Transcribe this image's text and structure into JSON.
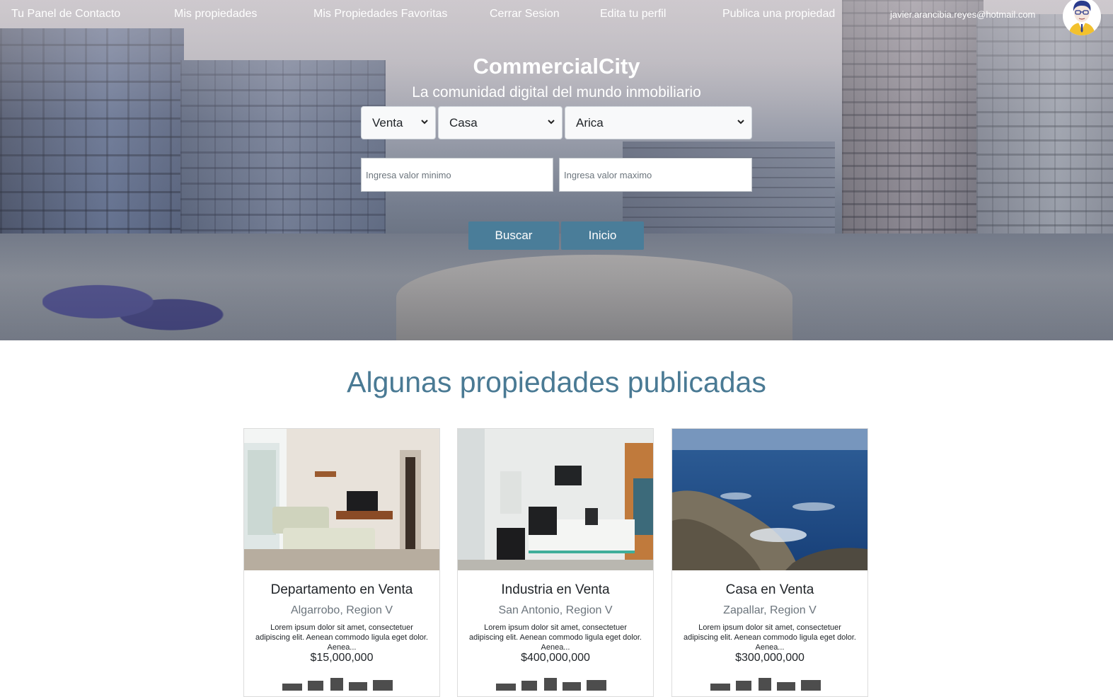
{
  "nav": {
    "links": [
      {
        "label": "Tu Panel de Contacto"
      },
      {
        "label": "Mis propiedades"
      },
      {
        "label": "Mis Propiedades Favoritas"
      },
      {
        "label": "Cerrar Sesion"
      },
      {
        "label": "Edita tu perfil"
      },
      {
        "label": "Publica una propiedad"
      }
    ],
    "email": "javier.arancibia.reyes@hotmail.com",
    "avatar_icon": "user-avatar-icon"
  },
  "hero": {
    "brand": "CommercialCity",
    "tagline": "La comunidad digital del mundo inmobiliario",
    "operation_select": {
      "value": "Venta"
    },
    "type_select": {
      "value": "Casa"
    },
    "city_select": {
      "value": "Arica"
    },
    "min_input": {
      "placeholder": "Ingresa valor minimo"
    },
    "max_input": {
      "placeholder": "Ingresa valor maximo"
    },
    "search_button": "Buscar",
    "home_button": "Inicio"
  },
  "listings": {
    "title": "Algunas propiedades publicadas",
    "cards": [
      {
        "title": "Departamento en Venta",
        "location": "Algarrobo, Region V",
        "description": "Lorem ipsum dolor sit amet, consectetuer adipiscing elit. Aenean commodo ligula eget dolor. Aenea...",
        "price": "$15,000,000",
        "image": "living-room-photo"
      },
      {
        "title": "Industria en Venta",
        "location": "San Antonio, Region V",
        "description": "Lorem ipsum dolor sit amet, consectetuer adipiscing elit. Aenean commodo ligula eget dolor. Aenea...",
        "price": "$400,000,000",
        "image": "office-photo"
      },
      {
        "title": "Casa en Venta",
        "location": "Zapallar, Region V",
        "description": "Lorem ipsum dolor sit amet, consectetuer adipiscing elit. Aenean commodo ligula eget dolor. Aenea...",
        "price": "$300,000,000",
        "image": "coast-photo"
      }
    ]
  },
  "colors": {
    "accent": "#4a7d99",
    "heading": "#4a7a94"
  }
}
